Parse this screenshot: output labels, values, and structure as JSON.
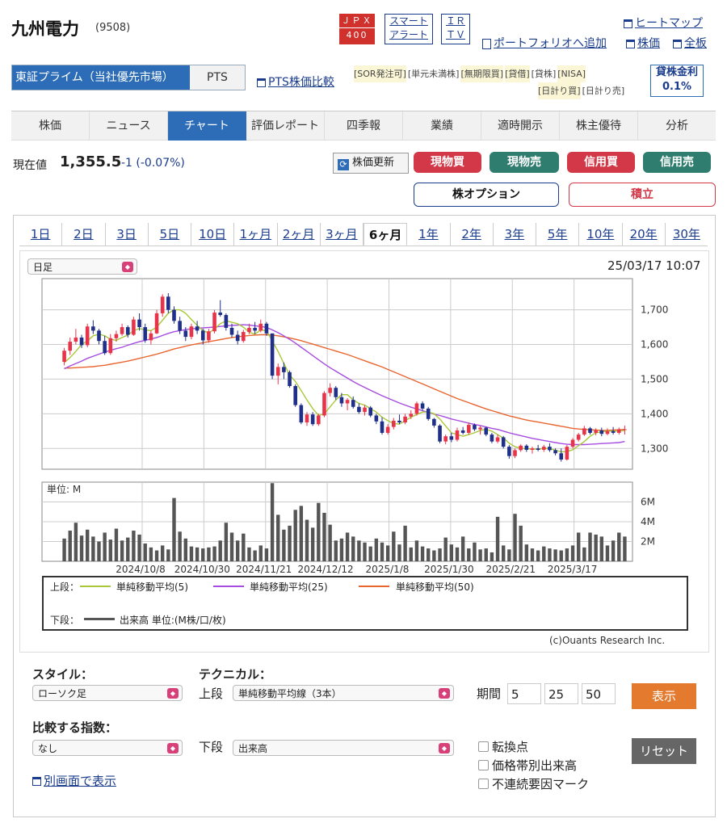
{
  "header": {
    "company": "九州電力",
    "code": "(9508)",
    "badge_jpx": "ＪＰＸ",
    "badge_400": "400",
    "badge_smart_1": "スマート",
    "badge_smart_2": "アラート",
    "badge_ir_1": "ＩＲ",
    "badge_ir_2": "ＴＶ",
    "links": {
      "heatmap": "ヒートマップ",
      "portfolio": "ポートフォリオへ追加",
      "price": "株価",
      "all": "全板"
    }
  },
  "market": {
    "selected": "東証プライム（当社優先市場）",
    "pts": "PTS",
    "pts_compare": "PTS株価比較"
  },
  "tags": [
    "[SOR発注可]",
    "[単元未満株]",
    "[無期限買]",
    "[貸借]",
    "[貸株]",
    "[NISA]",
    "[日計り買]",
    "[日計り売]"
  ],
  "lending": {
    "label": "貸株金利",
    "rate": "0.1%"
  },
  "tabs": [
    "株価",
    "ニュース",
    "チャート",
    "評価レポート",
    "四季報",
    "業績",
    "適時開示",
    "株主優待",
    "分析"
  ],
  "price": {
    "label": "現在値",
    "value": "1,355.5",
    "change": "-1 (-0.07%)",
    "refresh": "株価更新"
  },
  "trade_buttons": {
    "cash_buy": "現物買",
    "cash_sell": "現物売",
    "margin_buy": "信用買",
    "margin_sell": "信用売",
    "option": "株オプション",
    "accumulate": "積立"
  },
  "periods": [
    "1日",
    "2日",
    "3日",
    "5日",
    "10日",
    "1ヶ月",
    "2ヶ月",
    "3ヶ月",
    "6ヶ月",
    "1年",
    "2年",
    "3年",
    "5年",
    "10年",
    "20年",
    "30年"
  ],
  "chart_header": {
    "interval": "日足",
    "datetime": "25/03/17 10:07"
  },
  "legend": {
    "upper": "上段：",
    "lower": "下段：",
    "ma5": "単純移動平均(5)",
    "ma25": "単純移動平均(25)",
    "ma50": "単純移動平均(50)",
    "volume": "出来高 単位:(M株/口/枚)",
    "unit": "単位: M",
    "copyright": "(c)Ouants Research Inc."
  },
  "colors": {
    "up": "#e8344a",
    "down": "#1f2f8a",
    "ma5": "#a8c83a",
    "ma25": "#a64ce0",
    "ma50": "#e8652f",
    "volume": "#555555",
    "accent": "#2d6db7"
  },
  "controls": {
    "style_label": "スタイル：",
    "style_value": "ローソク足",
    "technical_label": "テクニカル：",
    "upper_label": "上段",
    "upper_value": "単純移動平均線（3本）",
    "period_label": "期間",
    "p1": "5",
    "p2": "25",
    "p3": "50",
    "show": "表示",
    "compare_label": "比較する指数：",
    "compare_value": "なし",
    "lower_label": "下段",
    "lower_value": "出来高",
    "cb1": "転換点",
    "cb2": "価格帯別出来高",
    "cb3": "不連続要因マーク",
    "reset": "リセット",
    "popout": "別画面で表示"
  },
  "chart_data": {
    "type": "candlestick",
    "price_ticks": [
      1300,
      1400,
      1500,
      1600,
      1700
    ],
    "price_tick_labels": [
      "1,300",
      "1,400",
      "1,500",
      "1,600",
      "1,700"
    ],
    "price_range": [
      1240,
      1790
    ],
    "volume_ticks": [
      2,
      4,
      6
    ],
    "volume_tick_labels": [
      "2M",
      "4M",
      "6M"
    ],
    "volume_range": [
      0,
      8
    ],
    "x_labels": [
      "2024/10/8",
      "2024/10/30",
      "2024/11/21",
      "2024/12/12",
      "2025/1/8",
      "2025/1/30",
      "2025/2/21",
      "2025/3/17"
    ],
    "candles_ohlc": [
      [
        1550,
        1590,
        1540,
        1582
      ],
      [
        1582,
        1620,
        1570,
        1608
      ],
      [
        1608,
        1645,
        1600,
        1620
      ],
      [
        1620,
        1628,
        1590,
        1598
      ],
      [
        1598,
        1660,
        1592,
        1652
      ],
      [
        1652,
        1670,
        1630,
        1640
      ],
      [
        1640,
        1645,
        1600,
        1610
      ],
      [
        1610,
        1625,
        1570,
        1575
      ],
      [
        1575,
        1630,
        1570,
        1618
      ],
      [
        1618,
        1640,
        1608,
        1630
      ],
      [
        1630,
        1660,
        1625,
        1650
      ],
      [
        1650,
        1655,
        1620,
        1628
      ],
      [
        1628,
        1680,
        1625,
        1672
      ],
      [
        1672,
        1690,
        1640,
        1650
      ],
      [
        1650,
        1660,
        1605,
        1612
      ],
      [
        1612,
        1640,
        1600,
        1632
      ],
      [
        1632,
        1700,
        1630,
        1690
      ],
      [
        1690,
        1745,
        1680,
        1738
      ],
      [
        1738,
        1748,
        1690,
        1700
      ],
      [
        1700,
        1710,
        1660,
        1668
      ],
      [
        1668,
        1680,
        1630,
        1640
      ],
      [
        1640,
        1650,
        1610,
        1622
      ],
      [
        1622,
        1660,
        1615,
        1652
      ],
      [
        1652,
        1668,
        1630,
        1640
      ],
      [
        1640,
        1645,
        1600,
        1612
      ],
      [
        1612,
        1645,
        1605,
        1638
      ],
      [
        1638,
        1700,
        1632,
        1692
      ],
      [
        1692,
        1728,
        1680,
        1685
      ],
      [
        1685,
        1690,
        1640,
        1648
      ],
      [
        1648,
        1660,
        1620,
        1628
      ],
      [
        1628,
        1640,
        1600,
        1610
      ],
      [
        1610,
        1642,
        1605,
        1636
      ],
      [
        1636,
        1660,
        1630,
        1648
      ],
      [
        1648,
        1665,
        1630,
        1640
      ],
      [
        1640,
        1672,
        1635,
        1660
      ],
      [
        1660,
        1665,
        1625,
        1632
      ],
      [
        1632,
        1560,
        1500,
        1510
      ],
      [
        1510,
        1545,
        1485,
        1535
      ],
      [
        1535,
        1548,
        1500,
        1520
      ],
      [
        1520,
        1525,
        1475,
        1480
      ],
      [
        1480,
        1485,
        1420,
        1425
      ],
      [
        1425,
        1430,
        1370,
        1375
      ],
      [
        1375,
        1405,
        1365,
        1398
      ],
      [
        1398,
        1405,
        1365,
        1370
      ],
      [
        1370,
        1400,
        1365,
        1395
      ],
      [
        1395,
        1465,
        1390,
        1460
      ],
      [
        1460,
        1488,
        1450,
        1475
      ],
      [
        1475,
        1480,
        1440,
        1448
      ],
      [
        1448,
        1460,
        1420,
        1430
      ],
      [
        1430,
        1445,
        1410,
        1440
      ],
      [
        1440,
        1450,
        1415,
        1420
      ],
      [
        1420,
        1430,
        1400,
        1405
      ],
      [
        1405,
        1425,
        1395,
        1418
      ],
      [
        1418,
        1422,
        1390,
        1395
      ],
      [
        1395,
        1400,
        1370,
        1378
      ],
      [
        1378,
        1390,
        1340,
        1345
      ],
      [
        1345,
        1370,
        1340,
        1362
      ],
      [
        1362,
        1388,
        1355,
        1380
      ],
      [
        1380,
        1398,
        1370,
        1375
      ],
      [
        1375,
        1400,
        1370,
        1392
      ],
      [
        1392,
        1410,
        1385,
        1400
      ],
      [
        1400,
        1435,
        1395,
        1430
      ],
      [
        1430,
        1436,
        1410,
        1415
      ],
      [
        1415,
        1420,
        1380,
        1385
      ],
      [
        1385,
        1388,
        1360,
        1366
      ],
      [
        1366,
        1370,
        1315,
        1320
      ],
      [
        1320,
        1340,
        1312,
        1335
      ],
      [
        1335,
        1345,
        1318,
        1325
      ],
      [
        1325,
        1360,
        1320,
        1352
      ],
      [
        1352,
        1362,
        1340,
        1345
      ],
      [
        1345,
        1375,
        1340,
        1368
      ],
      [
        1368,
        1372,
        1350,
        1355
      ],
      [
        1355,
        1365,
        1340,
        1360
      ],
      [
        1360,
        1362,
        1335,
        1340
      ],
      [
        1340,
        1345,
        1315,
        1320
      ],
      [
        1320,
        1340,
        1315,
        1332
      ],
      [
        1332,
        1336,
        1300,
        1305
      ],
      [
        1305,
        1310,
        1270,
        1278
      ],
      [
        1278,
        1300,
        1272,
        1295
      ],
      [
        1295,
        1312,
        1290,
        1308
      ],
      [
        1308,
        1312,
        1290,
        1296
      ],
      [
        1296,
        1305,
        1285,
        1300
      ],
      [
        1300,
        1310,
        1292,
        1296
      ],
      [
        1296,
        1310,
        1290,
        1305
      ],
      [
        1305,
        1315,
        1290,
        1295
      ],
      [
        1295,
        1300,
        1280,
        1286
      ],
      [
        1286,
        1300,
        1262,
        1268
      ],
      [
        1268,
        1310,
        1265,
        1305
      ],
      [
        1305,
        1330,
        1300,
        1325
      ],
      [
        1325,
        1345,
        1320,
        1340
      ],
      [
        1340,
        1365,
        1336,
        1358
      ],
      [
        1358,
        1362,
        1340,
        1345
      ],
      [
        1345,
        1358,
        1338,
        1352
      ],
      [
        1352,
        1360,
        1335,
        1342
      ],
      [
        1342,
        1358,
        1338,
        1350
      ],
      [
        1350,
        1362,
        1340,
        1345
      ],
      [
        1345,
        1360,
        1340,
        1355
      ],
      [
        1355,
        1366,
        1340,
        1355.5
      ]
    ],
    "ma5": [
      1548,
      1562,
      1580,
      1600,
      1610,
      1625,
      1630,
      1625,
      1615,
      1612,
      1620,
      1627,
      1640,
      1646,
      1642,
      1640,
      1650,
      1670,
      1690,
      1700,
      1700,
      1690,
      1672,
      1655,
      1640,
      1633,
      1645,
      1660,
      1668,
      1664,
      1660,
      1650,
      1635,
      1630,
      1642,
      1640,
      1610,
      1580,
      1545,
      1512,
      1493,
      1467,
      1440,
      1415,
      1395,
      1400,
      1420,
      1440,
      1455,
      1455,
      1440,
      1430,
      1425,
      1415,
      1405,
      1390,
      1380,
      1372,
      1370,
      1380,
      1390,
      1398,
      1405,
      1405,
      1400,
      1385,
      1365,
      1345,
      1340,
      1335,
      1340,
      1345,
      1352,
      1355,
      1350,
      1340,
      1330,
      1315,
      1305,
      1300,
      1300,
      1298,
      1298,
      1300,
      1300,
      1295,
      1290,
      1291,
      1296,
      1308,
      1320,
      1335,
      1345,
      1348,
      1350,
      1350,
      1350,
      1352
    ],
    "ma25": [
      1530,
      1538,
      1545,
      1552,
      1560,
      1566,
      1572,
      1578,
      1583,
      1588,
      1592,
      1598,
      1603,
      1608,
      1612,
      1616,
      1620,
      1626,
      1632,
      1637,
      1640,
      1643,
      1645,
      1647,
      1648,
      1649,
      1650,
      1652,
      1654,
      1655,
      1656,
      1657,
      1656,
      1654,
      1652,
      1649,
      1642,
      1634,
      1625,
      1615,
      1604,
      1592,
      1580,
      1568,
      1556,
      1544,
      1533,
      1523,
      1513,
      1503,
      1493,
      1484,
      1476,
      1468,
      1460,
      1452,
      1445,
      1438,
      1431,
      1425,
      1419,
      1414,
      1409,
      1404,
      1399,
      1395,
      1390,
      1385,
      1381,
      1377,
      1373,
      1369,
      1366,
      1362,
      1358,
      1355,
      1350,
      1345,
      1341,
      1337,
      1333,
      1329,
      1326,
      1323,
      1320,
      1317,
      1314,
      1312,
      1311,
      1311,
      1311,
      1312,
      1313,
      1314,
      1315,
      1316,
      1317,
      1320
    ],
    "ma50": [
      1532,
      1532,
      1533,
      1534,
      1535,
      1536,
      1538,
      1540,
      1543,
      1546,
      1549,
      1552,
      1556,
      1560,
      1564,
      1568,
      1572,
      1577,
      1582,
      1587,
      1591,
      1595,
      1599,
      1602,
      1605,
      1608,
      1611,
      1614,
      1617,
      1620,
      1622,
      1624,
      1626,
      1627,
      1628,
      1628,
      1627,
      1625,
      1622,
      1619,
      1615,
      1611,
      1606,
      1601,
      1596,
      1591,
      1586,
      1581,
      1576,
      1571,
      1565,
      1559,
      1553,
      1547,
      1541,
      1535,
      1528,
      1521,
      1514,
      1507,
      1500,
      1493,
      1486,
      1479,
      1472,
      1465,
      1458,
      1451,
      1444,
      1438,
      1432,
      1426,
      1420,
      1414,
      1409,
      1404,
      1399,
      1394,
      1390,
      1386,
      1382,
      1379,
      1376,
      1373,
      1370,
      1367,
      1364,
      1361,
      1358,
      1356,
      1355,
      1354,
      1353,
      1352,
      1352,
      1353,
      1354,
      1355
    ],
    "volume": [
      2.3,
      3.1,
      3.9,
      2.6,
      3.2,
      2.5,
      2.0,
      2.9,
      2.2,
      3.3,
      2.1,
      2.4,
      3.1,
      2.7,
      1.8,
      1.4,
      1.1,
      1.6,
      1.2,
      6.4,
      3.0,
      2.3,
      1.5,
      1.4,
      1.3,
      1.4,
      1.5,
      2.1,
      3.9,
      2.9,
      2.1,
      2.8,
      1.4,
      1.1,
      1.6,
      1.3,
      7.9,
      4.7,
      3.2,
      3.6,
      5.2,
      5.6,
      4.2,
      3.4,
      5.9,
      4.9,
      3.7,
      2.1,
      2.3,
      2.9,
      2.5,
      2.1,
      1.9,
      1.5,
      2.3,
      1.9,
      1.6,
      3.0,
      1.7,
      3.6,
      1.4,
      2.1,
      1.5,
      1.3,
      1.1,
      1.3,
      2.4,
      1.7,
      1.4,
      2.5,
      1.3,
      1.9,
      1.2,
      1.3,
      0.9,
      4.5,
      1.6,
      1.2,
      4.8,
      3.6,
      1.7,
      1.3,
      1.1,
      1.5,
      1.3,
      1.2,
      1.1,
      1.3,
      1.6,
      2.9,
      1.4,
      2.9,
      2.7,
      2.5,
      1.6,
      2.1,
      2.9,
      2.5
    ]
  }
}
